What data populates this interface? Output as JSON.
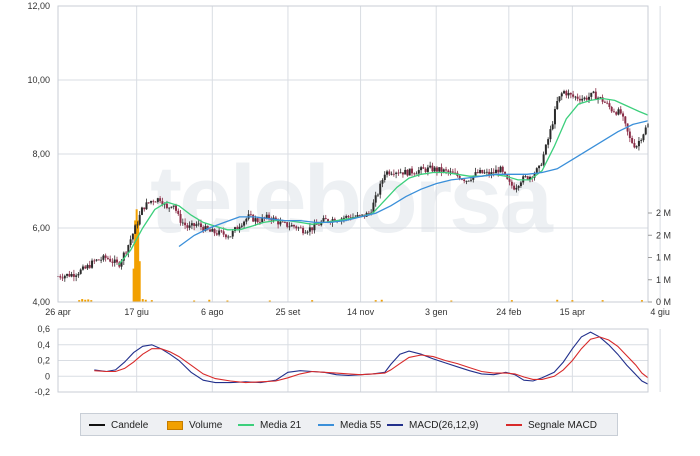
{
  "watermark": "teleborsa",
  "colors": {
    "candle_up": "#2b2b2b",
    "candle_down": "#8a2d47",
    "volume": "#f2a000",
    "ma21": "#3ccf7c",
    "ma55": "#3a8fd9",
    "macd": "#22308c",
    "signal": "#d82a2a",
    "grid": "#d9dde3"
  },
  "legend": [
    {
      "label": "Candele",
      "kind": "line",
      "color": "#111111"
    },
    {
      "label": "Volume",
      "kind": "bar",
      "color": "#f2a000"
    },
    {
      "label": "Media 21",
      "kind": "line",
      "color": "#3ccf7c"
    },
    {
      "label": "Media 55",
      "kind": "line",
      "color": "#3a8fd9"
    },
    {
      "label": "MACD(26,12,9)",
      "kind": "line",
      "color": "#22308c"
    },
    {
      "label": "Segnale MACD",
      "kind": "line",
      "color": "#d82a2a"
    }
  ],
  "chart_data": [
    {
      "type": "candlestick",
      "title": "",
      "x_ticks": [
        "26 apr",
        "17 giu",
        "6 ago",
        "25 set",
        "14 nov",
        "3 gen",
        "24 feb",
        "15 apr",
        "4 giu"
      ],
      "y_ticks": [
        "4,00",
        "6,00",
        "8,00",
        "10,00",
        "12,00"
      ],
      "ylim": [
        4,
        12
      ],
      "grid": true,
      "x_range": [
        0,
        390
      ],
      "x_tick_positions": [
        0,
        52,
        102,
        152,
        200,
        250,
        298,
        340,
        398
      ],
      "price_path": [
        [
          0,
          4.7
        ],
        [
          10,
          4.75
        ],
        [
          18,
          4.9
        ],
        [
          24,
          5.1
        ],
        [
          32,
          5.2
        ],
        [
          40,
          5.0
        ],
        [
          46,
          5.5
        ],
        [
          52,
          6.1
        ],
        [
          56,
          6.55
        ],
        [
          62,
          6.75
        ],
        [
          68,
          6.8
        ],
        [
          72,
          6.5
        ],
        [
          76,
          6.7
        ],
        [
          80,
          6.25
        ],
        [
          86,
          6.0
        ],
        [
          92,
          6.1
        ],
        [
          100,
          5.9
        ],
        [
          108,
          5.85
        ],
        [
          114,
          5.8
        ],
        [
          120,
          6.1
        ],
        [
          126,
          6.3
        ],
        [
          132,
          6.2
        ],
        [
          140,
          6.3
        ],
        [
          148,
          6.1
        ],
        [
          156,
          6.05
        ],
        [
          162,
          5.95
        ],
        [
          168,
          6.0
        ],
        [
          176,
          6.2
        ],
        [
          184,
          6.25
        ],
        [
          192,
          6.3
        ],
        [
          200,
          6.3
        ],
        [
          206,
          6.4
        ],
        [
          212,
          7.0
        ],
        [
          216,
          7.5
        ],
        [
          222,
          7.55
        ],
        [
          230,
          7.5
        ],
        [
          238,
          7.55
        ],
        [
          246,
          7.6
        ],
        [
          254,
          7.55
        ],
        [
          262,
          7.45
        ],
        [
          270,
          7.3
        ],
        [
          278,
          7.5
        ],
        [
          286,
          7.45
        ],
        [
          292,
          7.6
        ],
        [
          298,
          7.2
        ],
        [
          302,
          7.1
        ],
        [
          306,
          7.3
        ],
        [
          312,
          7.4
        ],
        [
          318,
          7.6
        ],
        [
          322,
          8.1
        ],
        [
          326,
          8.7
        ],
        [
          330,
          9.4
        ],
        [
          334,
          9.7
        ],
        [
          340,
          9.55
        ],
        [
          348,
          9.5
        ],
        [
          354,
          9.6
        ],
        [
          360,
          9.45
        ],
        [
          366,
          9.2
        ],
        [
          372,
          9.1
        ],
        [
          378,
          8.4
        ],
        [
          382,
          8.2
        ],
        [
          386,
          8.5
        ],
        [
          390,
          8.8
        ]
      ],
      "series": [
        {
          "name": "Media 21",
          "values": [
            [
              40,
              5.0
            ],
            [
              48,
              5.4
            ],
            [
              56,
              6.0
            ],
            [
              64,
              6.5
            ],
            [
              72,
              6.7
            ],
            [
              80,
              6.6
            ],
            [
              88,
              6.35
            ],
            [
              96,
              6.15
            ],
            [
              104,
              6.05
            ],
            [
              112,
              5.95
            ],
            [
              120,
              5.95
            ],
            [
              128,
              6.05
            ],
            [
              136,
              6.15
            ],
            [
              144,
              6.2
            ],
            [
              152,
              6.2
            ],
            [
              160,
              6.15
            ],
            [
              168,
              6.1
            ],
            [
              176,
              6.15
            ],
            [
              184,
              6.2
            ],
            [
              192,
              6.25
            ],
            [
              200,
              6.3
            ],
            [
              208,
              6.4
            ],
            [
              216,
              6.75
            ],
            [
              224,
              7.1
            ],
            [
              232,
              7.35
            ],
            [
              240,
              7.45
            ],
            [
              248,
              7.5
            ],
            [
              256,
              7.5
            ],
            [
              264,
              7.45
            ],
            [
              272,
              7.4
            ],
            [
              280,
              7.4
            ],
            [
              288,
              7.45
            ],
            [
              296,
              7.4
            ],
            [
              304,
              7.3
            ],
            [
              312,
              7.3
            ],
            [
              320,
              7.55
            ],
            [
              328,
              8.2
            ],
            [
              336,
              8.95
            ],
            [
              344,
              9.35
            ],
            [
              352,
              9.45
            ],
            [
              360,
              9.5
            ],
            [
              368,
              9.45
            ],
            [
              376,
              9.3
            ],
            [
              384,
              9.15
            ],
            [
              390,
              9.05
            ]
          ]
        },
        {
          "name": "Media 55",
          "values": [
            [
              80,
              5.5
            ],
            [
              90,
              5.8
            ],
            [
              100,
              6.0
            ],
            [
              110,
              6.15
            ],
            [
              120,
              6.3
            ],
            [
              130,
              6.3
            ],
            [
              140,
              6.25
            ],
            [
              150,
              6.2
            ],
            [
              160,
              6.2
            ],
            [
              170,
              6.15
            ],
            [
              180,
              6.15
            ],
            [
              190,
              6.2
            ],
            [
              200,
              6.3
            ],
            [
              210,
              6.4
            ],
            [
              220,
              6.6
            ],
            [
              230,
              6.85
            ],
            [
              240,
              7.05
            ],
            [
              250,
              7.2
            ],
            [
              260,
              7.3
            ],
            [
              270,
              7.35
            ],
            [
              280,
              7.4
            ],
            [
              290,
              7.45
            ],
            [
              300,
              7.45
            ],
            [
              310,
              7.45
            ],
            [
              320,
              7.5
            ],
            [
              330,
              7.6
            ],
            [
              340,
              7.85
            ],
            [
              350,
              8.1
            ],
            [
              360,
              8.35
            ],
            [
              370,
              8.6
            ],
            [
              380,
              8.8
            ],
            [
              390,
              8.9
            ]
          ]
        }
      ]
    },
    {
      "type": "bar",
      "title": "Volume",
      "y_ticks": [
        "0 M",
        "1 M",
        "1 M",
        "2 M",
        "2 M"
      ],
      "ylim": [
        0,
        2.4
      ],
      "values": [
        [
          14,
          0.05
        ],
        [
          16,
          0.08
        ],
        [
          18,
          0.06
        ],
        [
          20,
          0.07
        ],
        [
          22,
          0.05
        ],
        [
          50,
          0.9
        ],
        [
          51,
          2.2
        ],
        [
          52,
          2.5
        ],
        [
          53,
          2.2
        ],
        [
          54,
          1.1
        ],
        [
          56,
          0.08
        ],
        [
          58,
          0.06
        ],
        [
          62,
          0.05
        ],
        [
          90,
          0.04
        ],
        [
          100,
          0.06
        ],
        [
          112,
          0.04
        ],
        [
          140,
          0.04
        ],
        [
          168,
          0.05
        ],
        [
          210,
          0.05
        ],
        [
          214,
          0.06
        ],
        [
          260,
          0.04
        ],
        [
          300,
          0.05
        ],
        [
          330,
          0.06
        ],
        [
          340,
          0.05
        ],
        [
          360,
          0.05
        ],
        [
          386,
          0.05
        ]
      ]
    },
    {
      "type": "line",
      "title": "MACD",
      "y_ticks": [
        "-0,2",
        "0",
        "0,2",
        "0,4",
        "0,6"
      ],
      "ylim": [
        -0.2,
        0.6
      ],
      "series": [
        {
          "name": "MACD(26,12,9)",
          "values": [
            [
              24,
              0.08
            ],
            [
              32,
              0.06
            ],
            [
              38,
              0.08
            ],
            [
              44,
              0.18
            ],
            [
              50,
              0.3
            ],
            [
              56,
              0.38
            ],
            [
              62,
              0.4
            ],
            [
              68,
              0.35
            ],
            [
              74,
              0.28
            ],
            [
              80,
              0.2
            ],
            [
              88,
              0.05
            ],
            [
              96,
              -0.05
            ],
            [
              104,
              -0.08
            ],
            [
              114,
              -0.08
            ],
            [
              124,
              -0.07
            ],
            [
              134,
              -0.08
            ],
            [
              144,
              -0.05
            ],
            [
              152,
              0.05
            ],
            [
              160,
              0.07
            ],
            [
              168,
              0.06
            ],
            [
              176,
              0.05
            ],
            [
              184,
              0.02
            ],
            [
              192,
              0.01
            ],
            [
              200,
              0.02
            ],
            [
              208,
              0.03
            ],
            [
              216,
              0.05
            ],
            [
              220,
              0.15
            ],
            [
              226,
              0.28
            ],
            [
              232,
              0.32
            ],
            [
              240,
              0.28
            ],
            [
              248,
              0.22
            ],
            [
              256,
              0.17
            ],
            [
              264,
              0.12
            ],
            [
              272,
              0.07
            ],
            [
              280,
              0.03
            ],
            [
              288,
              0.02
            ],
            [
              296,
              0.05
            ],
            [
              302,
              0.02
            ],
            [
              308,
              -0.05
            ],
            [
              314,
              -0.06
            ],
            [
              320,
              -0.02
            ],
            [
              328,
              0.05
            ],
            [
              334,
              0.18
            ],
            [
              340,
              0.35
            ],
            [
              346,
              0.5
            ],
            [
              352,
              0.56
            ],
            [
              358,
              0.5
            ],
            [
              364,
              0.4
            ],
            [
              370,
              0.28
            ],
            [
              376,
              0.14
            ],
            [
              382,
              0.02
            ],
            [
              386,
              -0.06
            ],
            [
              390,
              -0.1
            ]
          ]
        },
        {
          "name": "Segnale MACD",
          "values": [
            [
              24,
              0.07
            ],
            [
              32,
              0.06
            ],
            [
              38,
              0.06
            ],
            [
              44,
              0.1
            ],
            [
              50,
              0.18
            ],
            [
              56,
              0.28
            ],
            [
              62,
              0.35
            ],
            [
              68,
              0.35
            ],
            [
              74,
              0.31
            ],
            [
              80,
              0.25
            ],
            [
              88,
              0.14
            ],
            [
              96,
              0.03
            ],
            [
              104,
              -0.03
            ],
            [
              114,
              -0.06
            ],
            [
              124,
              -0.08
            ],
            [
              134,
              -0.07
            ],
            [
              144,
              -0.06
            ],
            [
              152,
              -0.02
            ],
            [
              160,
              0.03
            ],
            [
              168,
              0.06
            ],
            [
              176,
              0.05
            ],
            [
              184,
              0.04
            ],
            [
              192,
              0.03
            ],
            [
              200,
              0.02
            ],
            [
              208,
              0.03
            ],
            [
              216,
              0.04
            ],
            [
              220,
              0.08
            ],
            [
              226,
              0.16
            ],
            [
              232,
              0.24
            ],
            [
              240,
              0.27
            ],
            [
              248,
              0.25
            ],
            [
              256,
              0.2
            ],
            [
              264,
              0.16
            ],
            [
              272,
              0.11
            ],
            [
              280,
              0.06
            ],
            [
              288,
              0.04
            ],
            [
              296,
              0.04
            ],
            [
              302,
              0.03
            ],
            [
              308,
              -0.01
            ],
            [
              314,
              -0.04
            ],
            [
              320,
              -0.04
            ],
            [
              328,
              0.0
            ],
            [
              334,
              0.08
            ],
            [
              340,
              0.2
            ],
            [
              346,
              0.35
            ],
            [
              352,
              0.47
            ],
            [
              358,
              0.5
            ],
            [
              364,
              0.46
            ],
            [
              370,
              0.38
            ],
            [
              376,
              0.26
            ],
            [
              382,
              0.14
            ],
            [
              386,
              0.04
            ],
            [
              390,
              -0.02
            ]
          ]
        }
      ]
    }
  ]
}
